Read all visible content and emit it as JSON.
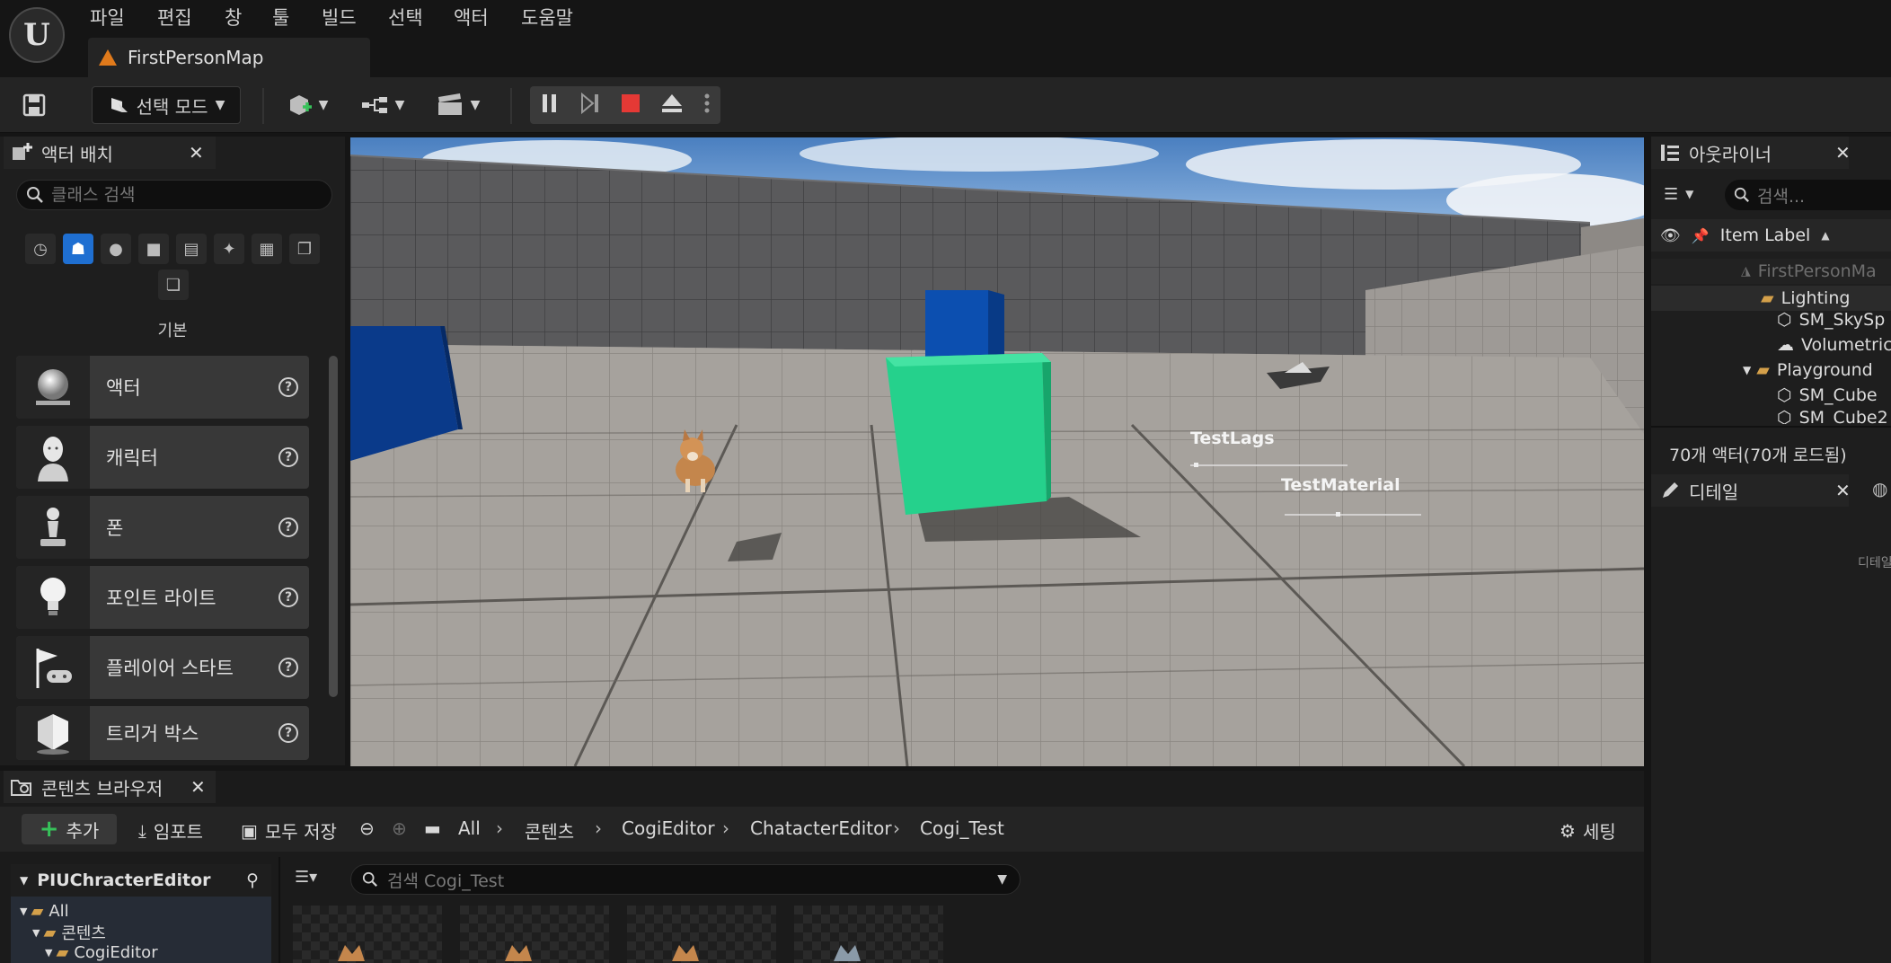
{
  "menu": {
    "items": [
      "파일",
      "편집",
      "창",
      "툴",
      "빌드",
      "선택",
      "액터",
      "도움말"
    ]
  },
  "map_tab": {
    "label": "FirstPersonMap"
  },
  "toolbar": {
    "mode_label": "선택 모드"
  },
  "place_actors": {
    "title": "액터 배치",
    "search_placeholder": "클래스 검색",
    "category_label": "기본",
    "items": [
      {
        "label": "액터",
        "icon": "sphere-icon"
      },
      {
        "label": "캐릭터",
        "icon": "character-icon"
      },
      {
        "label": "폰",
        "icon": "pawn-icon"
      },
      {
        "label": "포인트 라이트",
        "icon": "light-bulb-icon"
      },
      {
        "label": "플레이어 스타트",
        "icon": "player-start-icon"
      },
      {
        "label": "트리거 박스",
        "icon": "trigger-box-icon"
      }
    ]
  },
  "viewport": {
    "labels": [
      "TestLags",
      "TestMaterial"
    ]
  },
  "outliner": {
    "title": "아웃라이너",
    "search_placeholder": "검색...",
    "column_label": "Item Label",
    "tree": [
      {
        "label": "FirstPersonMa",
        "level": 0,
        "type": "map"
      },
      {
        "label": "Lighting",
        "level": 1,
        "type": "folder"
      },
      {
        "label": "SM_SkySp",
        "level": 2,
        "type": "mesh"
      },
      {
        "label": "Volumetric",
        "level": 2,
        "type": "cloud"
      },
      {
        "label": "Playground",
        "level": 1,
        "type": "folder"
      },
      {
        "label": "SM_Cube",
        "level": 2,
        "type": "mesh"
      },
      {
        "label": "SM_Cube2",
        "level": 2,
        "type": "mesh"
      }
    ],
    "actor_count": "70개 액터(70개 로드됨)"
  },
  "details": {
    "title": "디테일",
    "hint": "디테일"
  },
  "content_browser": {
    "title": "콘텐츠 브라우저",
    "add_label": "추가",
    "import_label": "임포트",
    "save_all_label": "모두 저장",
    "breadcrumbs": [
      "All",
      "콘텐츠",
      "CogiEditor",
      "ChatacterEditor",
      "Cogi_Test"
    ],
    "settings_label": "세팅",
    "tree_title": "PIUChracterEditor",
    "tree": [
      "All",
      "콘텐츠",
      "CogiEditor"
    ],
    "search_placeholder": "검색 Cogi_Test"
  }
}
